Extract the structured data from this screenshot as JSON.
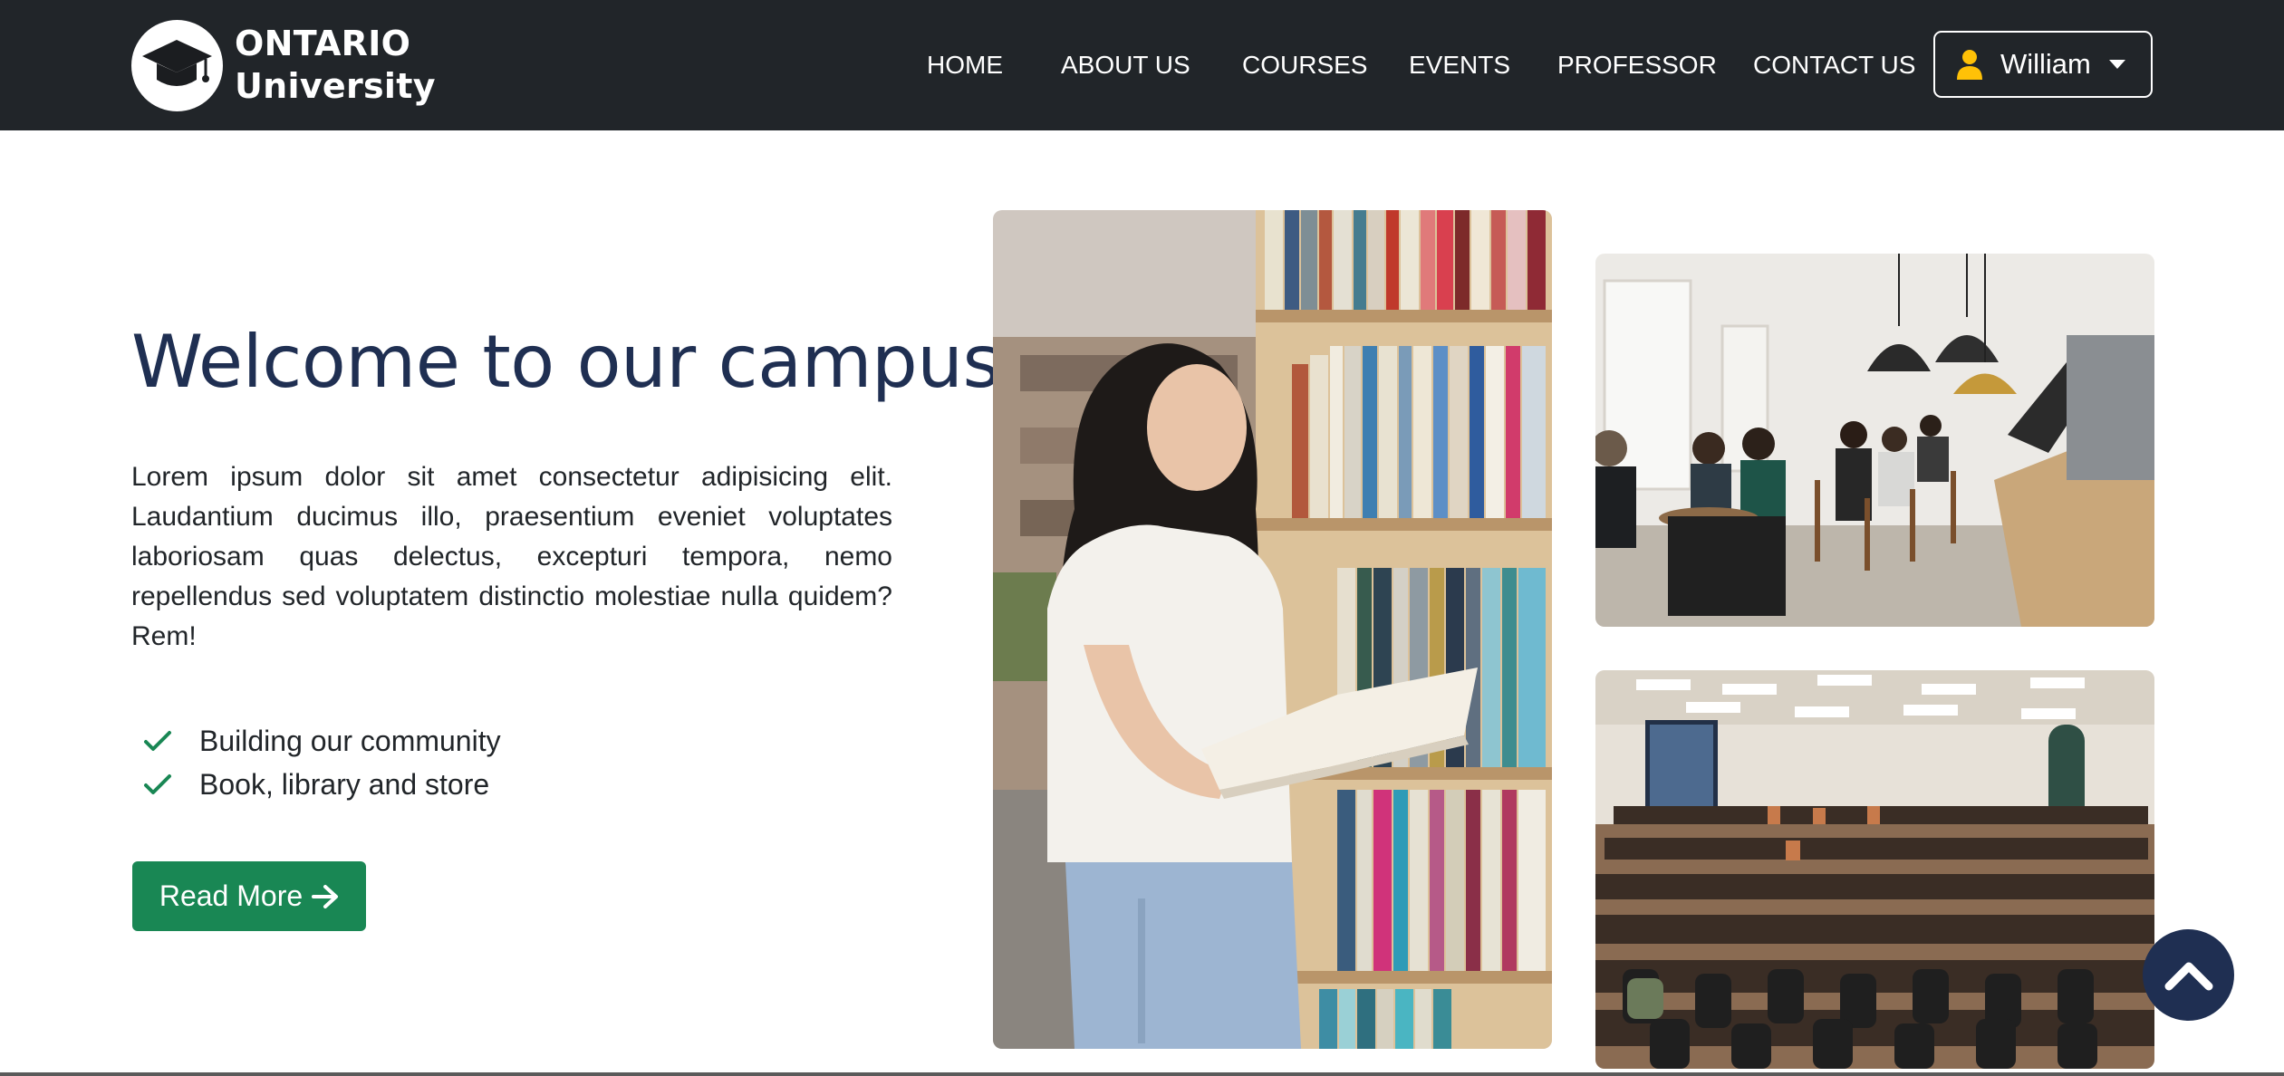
{
  "brand": {
    "line1": "ONTARIO",
    "line2": "University",
    "logo_icon": "graduation-cap-icon"
  },
  "nav": {
    "items": [
      {
        "label": "HOME"
      },
      {
        "label": "ABOUT US"
      },
      {
        "label": "COURSES"
      },
      {
        "label": "EVENTS"
      },
      {
        "label": "PROFESSOR"
      },
      {
        "label": "CONTACT US"
      }
    ],
    "user": {
      "name": "William",
      "icon": "user-icon",
      "icon_color": "#ffc107"
    }
  },
  "hero": {
    "title": "Welcome to our campus",
    "paragraph": "Lorem ipsum dolor sit amet consectetur adipisicing elit. Laudantium ducimus illo, praesentium eveniet voluptates laboriosam quas delectus, excepturi tempora, nemo repellendus sed voluptatem distinctio molestiae nulla quidem? Rem!",
    "features": [
      {
        "label": "Building our community",
        "icon": "check-icon"
      },
      {
        "label": "Book, library and store",
        "icon": "check-icon"
      }
    ],
    "read_more_label": "Read More",
    "read_more_icon": "arrow-right-icon"
  },
  "colors": {
    "navbar_bg": "#212529",
    "title": "#1f2f52",
    "accent_green": "#198754",
    "user_icon": "#ffc107",
    "back_to_top_bg": "#1f2f52"
  },
  "images": [
    {
      "name": "student-reading-in-library-photo"
    },
    {
      "name": "campus-cafe-photo"
    },
    {
      "name": "lecture-hall-photo"
    }
  ],
  "back_to_top_icon": "chevron-up-icon"
}
